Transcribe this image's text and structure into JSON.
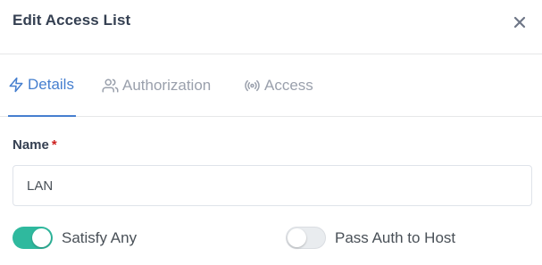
{
  "modal": {
    "title": "Edit Access List",
    "close_icon": "close-icon"
  },
  "tabs": [
    {
      "label": "Details",
      "icon": "lightning-icon",
      "active": true
    },
    {
      "label": "Authorization",
      "icon": "users-icon",
      "active": false
    },
    {
      "label": "Access",
      "icon": "broadcast-icon",
      "active": false
    }
  ],
  "form": {
    "name_label": "Name",
    "required_mark": "*",
    "name_value": "LAN"
  },
  "toggles": [
    {
      "label": "Satisfy Any",
      "checked": true
    },
    {
      "label": "Pass Auth to Host",
      "checked": false
    }
  ],
  "colors": {
    "accent": "#467fcf",
    "toggle_on": "#2fb99e",
    "required": "#cd201f"
  }
}
